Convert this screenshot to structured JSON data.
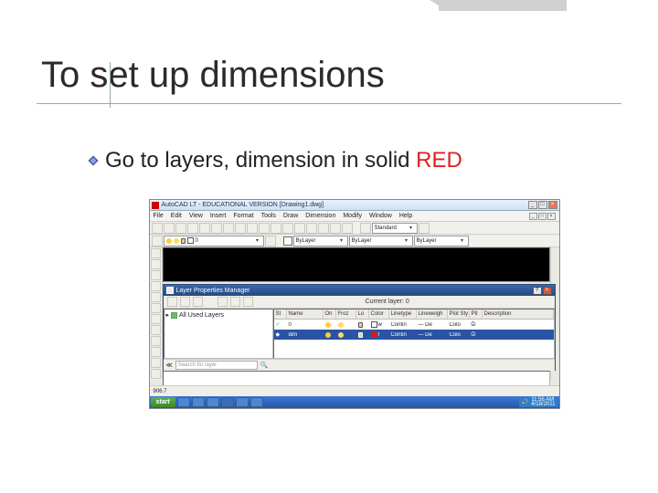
{
  "slide": {
    "title": "To set up dimensions",
    "bullet_prefix": "Go to layers, dimension in solid ",
    "bullet_highlight": "RED"
  },
  "acad": {
    "title": "AutoCAD LT - EDUCATIONAL VERSION   [Drawing1.dwg]",
    "menu": [
      "File",
      "Edit",
      "View",
      "Insert",
      "Format",
      "Tools",
      "Draw",
      "Dimension",
      "Modify",
      "Window",
      "Help"
    ],
    "style_sel": "Standard",
    "layer_sel": "0",
    "color_sel": "ByLayer",
    "ltype_sel": "ByLayer",
    "status": "906.7"
  },
  "lpm": {
    "title": "Layer Properties Manager",
    "current_label": "Current layer: 0",
    "tree_root": "All Used Layers",
    "search_placeholder": "Search for layer",
    "columns": [
      "St",
      "Name",
      "On",
      "Froz",
      "Lo",
      "Color",
      "Linetype",
      "Lineweigh",
      "Plot Sty",
      "Plt",
      "Description"
    ],
    "rows": [
      {
        "name": "0",
        "color_label": "w",
        "linetype": "Contin",
        "lineweight": "— De",
        "plot": "Colo",
        "selected": false,
        "swatch": "sw-w"
      },
      {
        "name": "dim",
        "color_label": "r",
        "linetype": "Contin",
        "lineweight": "— De",
        "plot": "Colo",
        "selected": true,
        "swatch": "sw-r"
      }
    ]
  },
  "taskbar": {
    "start": "start",
    "time": "11:56 AM",
    "date": "4/18/2011"
  }
}
